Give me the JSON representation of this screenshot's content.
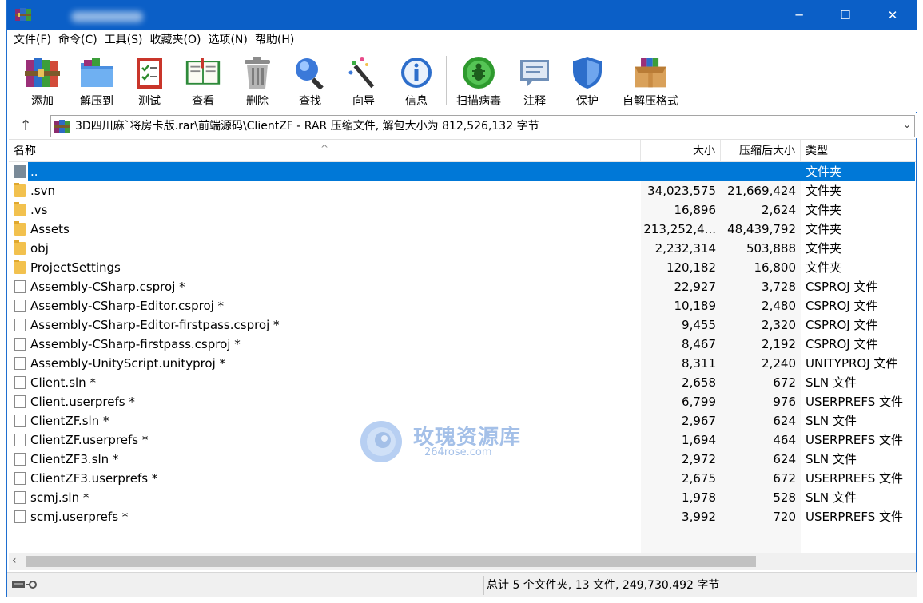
{
  "window": {
    "controls": {
      "minimize": "─",
      "maximize": "☐",
      "close": "✕"
    }
  },
  "menu": [
    {
      "label": "文件(F)"
    },
    {
      "label": "命令(C)"
    },
    {
      "label": "工具(S)"
    },
    {
      "label": "收藏夹(O)"
    },
    {
      "label": "选项(N)"
    },
    {
      "label": "帮助(H)"
    }
  ],
  "toolbar": {
    "buttons": [
      {
        "label": "添加",
        "icon": "books-stack-icon"
      },
      {
        "label": "解压到",
        "icon": "folder-extract-icon"
      },
      {
        "label": "测试",
        "icon": "checklist-icon"
      },
      {
        "label": "查看",
        "icon": "open-book-icon"
      },
      {
        "label": "删除",
        "icon": "trash-can-icon"
      },
      {
        "label": "查找",
        "icon": "magnifier-icon"
      },
      {
        "label": "向导",
        "icon": "magic-wand-icon"
      },
      {
        "label": "信息",
        "icon": "info-icon"
      },
      {
        "label": "扫描病毒",
        "icon": "bug-scan-icon"
      },
      {
        "label": "注释",
        "icon": "speech-bubble-icon"
      },
      {
        "label": "保护",
        "icon": "shield-icon"
      },
      {
        "label": "自解压格式",
        "icon": "box-icon"
      }
    ]
  },
  "path": {
    "text": "3D四川麻`将房卡版.rar\\前端源码\\ClientZF - RAR 压缩文件, 解包大小为 812,526,132 字节"
  },
  "columns": {
    "name": "名称",
    "size": "大小",
    "packed": "压缩后大小",
    "type": "类型"
  },
  "files": [
    {
      "name": "..",
      "size": "",
      "packed": "",
      "type": "文件夹",
      "kind": "up",
      "selected": true
    },
    {
      "name": ".svn",
      "size": "34,023,575",
      "packed": "21,669,424",
      "type": "文件夹",
      "kind": "folder"
    },
    {
      "name": ".vs",
      "size": "16,896",
      "packed": "2,624",
      "type": "文件夹",
      "kind": "folder"
    },
    {
      "name": "Assets",
      "size": "213,252,4...",
      "packed": "48,439,792",
      "type": "文件夹",
      "kind": "folder"
    },
    {
      "name": "obj",
      "size": "2,232,314",
      "packed": "503,888",
      "type": "文件夹",
      "kind": "folder"
    },
    {
      "name": "ProjectSettings",
      "size": "120,182",
      "packed": "16,800",
      "type": "文件夹",
      "kind": "folder"
    },
    {
      "name": "Assembly-CSharp.csproj *",
      "size": "22,927",
      "packed": "3,728",
      "type": "CSPROJ 文件",
      "kind": "file"
    },
    {
      "name": "Assembly-CSharp-Editor.csproj *",
      "size": "10,189",
      "packed": "2,480",
      "type": "CSPROJ 文件",
      "kind": "file"
    },
    {
      "name": "Assembly-CSharp-Editor-firstpass.csproj *",
      "size": "9,455",
      "packed": "2,320",
      "type": "CSPROJ 文件",
      "kind": "file"
    },
    {
      "name": "Assembly-CSharp-firstpass.csproj *",
      "size": "8,467",
      "packed": "2,192",
      "type": "CSPROJ 文件",
      "kind": "file"
    },
    {
      "name": "Assembly-UnityScript.unityproj *",
      "size": "8,311",
      "packed": "2,240",
      "type": "UNITYPROJ 文件",
      "kind": "file"
    },
    {
      "name": "Client.sln *",
      "size": "2,658",
      "packed": "672",
      "type": "SLN 文件",
      "kind": "file"
    },
    {
      "name": "Client.userprefs *",
      "size": "6,799",
      "packed": "976",
      "type": "USERPREFS 文件",
      "kind": "file"
    },
    {
      "name": "ClientZF.sln *",
      "size": "2,967",
      "packed": "624",
      "type": "SLN 文件",
      "kind": "file"
    },
    {
      "name": "ClientZF.userprefs *",
      "size": "1,694",
      "packed": "464",
      "type": "USERPREFS 文件",
      "kind": "file"
    },
    {
      "name": "ClientZF3.sln *",
      "size": "2,972",
      "packed": "624",
      "type": "SLN 文件",
      "kind": "file"
    },
    {
      "name": "ClientZF3.userprefs *",
      "size": "2,675",
      "packed": "672",
      "type": "USERPREFS 文件",
      "kind": "file"
    },
    {
      "name": "scmj.sln *",
      "size": "1,978",
      "packed": "528",
      "type": "SLN 文件",
      "kind": "file"
    },
    {
      "name": "scmj.userprefs *",
      "size": "3,992",
      "packed": "720",
      "type": "USERPREFS 文件",
      "kind": "file"
    }
  ],
  "watermark": {
    "title": "玫瑰资源库",
    "subtitle": "264rose.com"
  },
  "status": {
    "summary": "总计 5 个文件夹, 13 文件, 249,730,492 字节"
  },
  "colors": {
    "titlebar": "#0b5fc7",
    "selection": "#0078d7",
    "folder": "#f2c14e"
  }
}
